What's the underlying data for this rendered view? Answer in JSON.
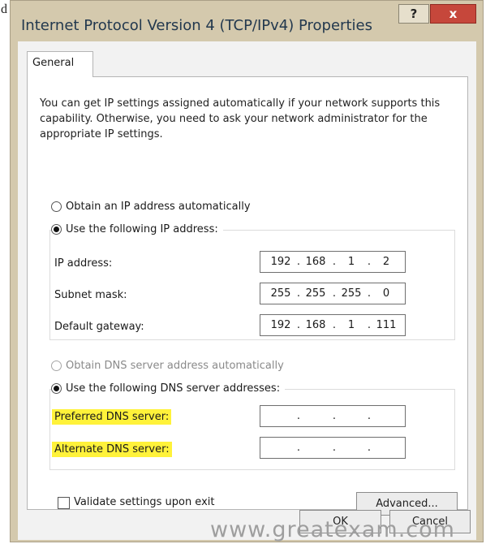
{
  "page": {
    "edge_fragment": "d"
  },
  "window": {
    "title": "Internet Protocol Version 4 (TCP/IPv4) Properties",
    "help_label": "?",
    "close_label": "x"
  },
  "tabs": [
    {
      "label": "General",
      "selected": true
    }
  ],
  "general": {
    "description": "You can get IP settings assigned automatically if your network supports this capability. Otherwise, you need to ask your network administrator for the appropriate IP settings.",
    "ip_mode": {
      "auto_label": "Obtain an IP address automatically",
      "manual_label": "Use the following IP address:",
      "selected": "manual"
    },
    "ip_fields": {
      "ip_address": {
        "label": "IP address:",
        "octets": [
          "192",
          "168",
          "1",
          "2"
        ]
      },
      "subnet_mask": {
        "label": "Subnet mask:",
        "octets": [
          "255",
          "255",
          "255",
          "0"
        ]
      },
      "default_gateway": {
        "label": "Default gateway:",
        "octets": [
          "192",
          "168",
          "1",
          "111"
        ]
      }
    },
    "dns_mode": {
      "auto_label": "Obtain DNS server address automatically",
      "manual_label": "Use the following DNS server addresses:",
      "selected": "manual",
      "auto_disabled": true
    },
    "dns_fields": {
      "preferred": {
        "label": "Preferred DNS server:",
        "octets": [
          "",
          "",
          "",
          ""
        ],
        "highlighted": true
      },
      "alternate": {
        "label": "Alternate DNS server:",
        "octets": [
          "",
          "",
          "",
          ""
        ],
        "highlighted": true
      }
    },
    "validate": {
      "label": "Validate settings upon exit",
      "checked": false
    },
    "advanced_label": "Advanced..."
  },
  "buttons": {
    "ok_label": "OK",
    "cancel_label": "Cancel"
  },
  "watermark": "www.greatexam.com",
  "colors": {
    "frame": "#d4c9ad",
    "title_text": "#22384e",
    "close_button": "#c6473b",
    "highlight": "#fff23a",
    "panel": "#ffffff",
    "client": "#f2f2f2"
  }
}
